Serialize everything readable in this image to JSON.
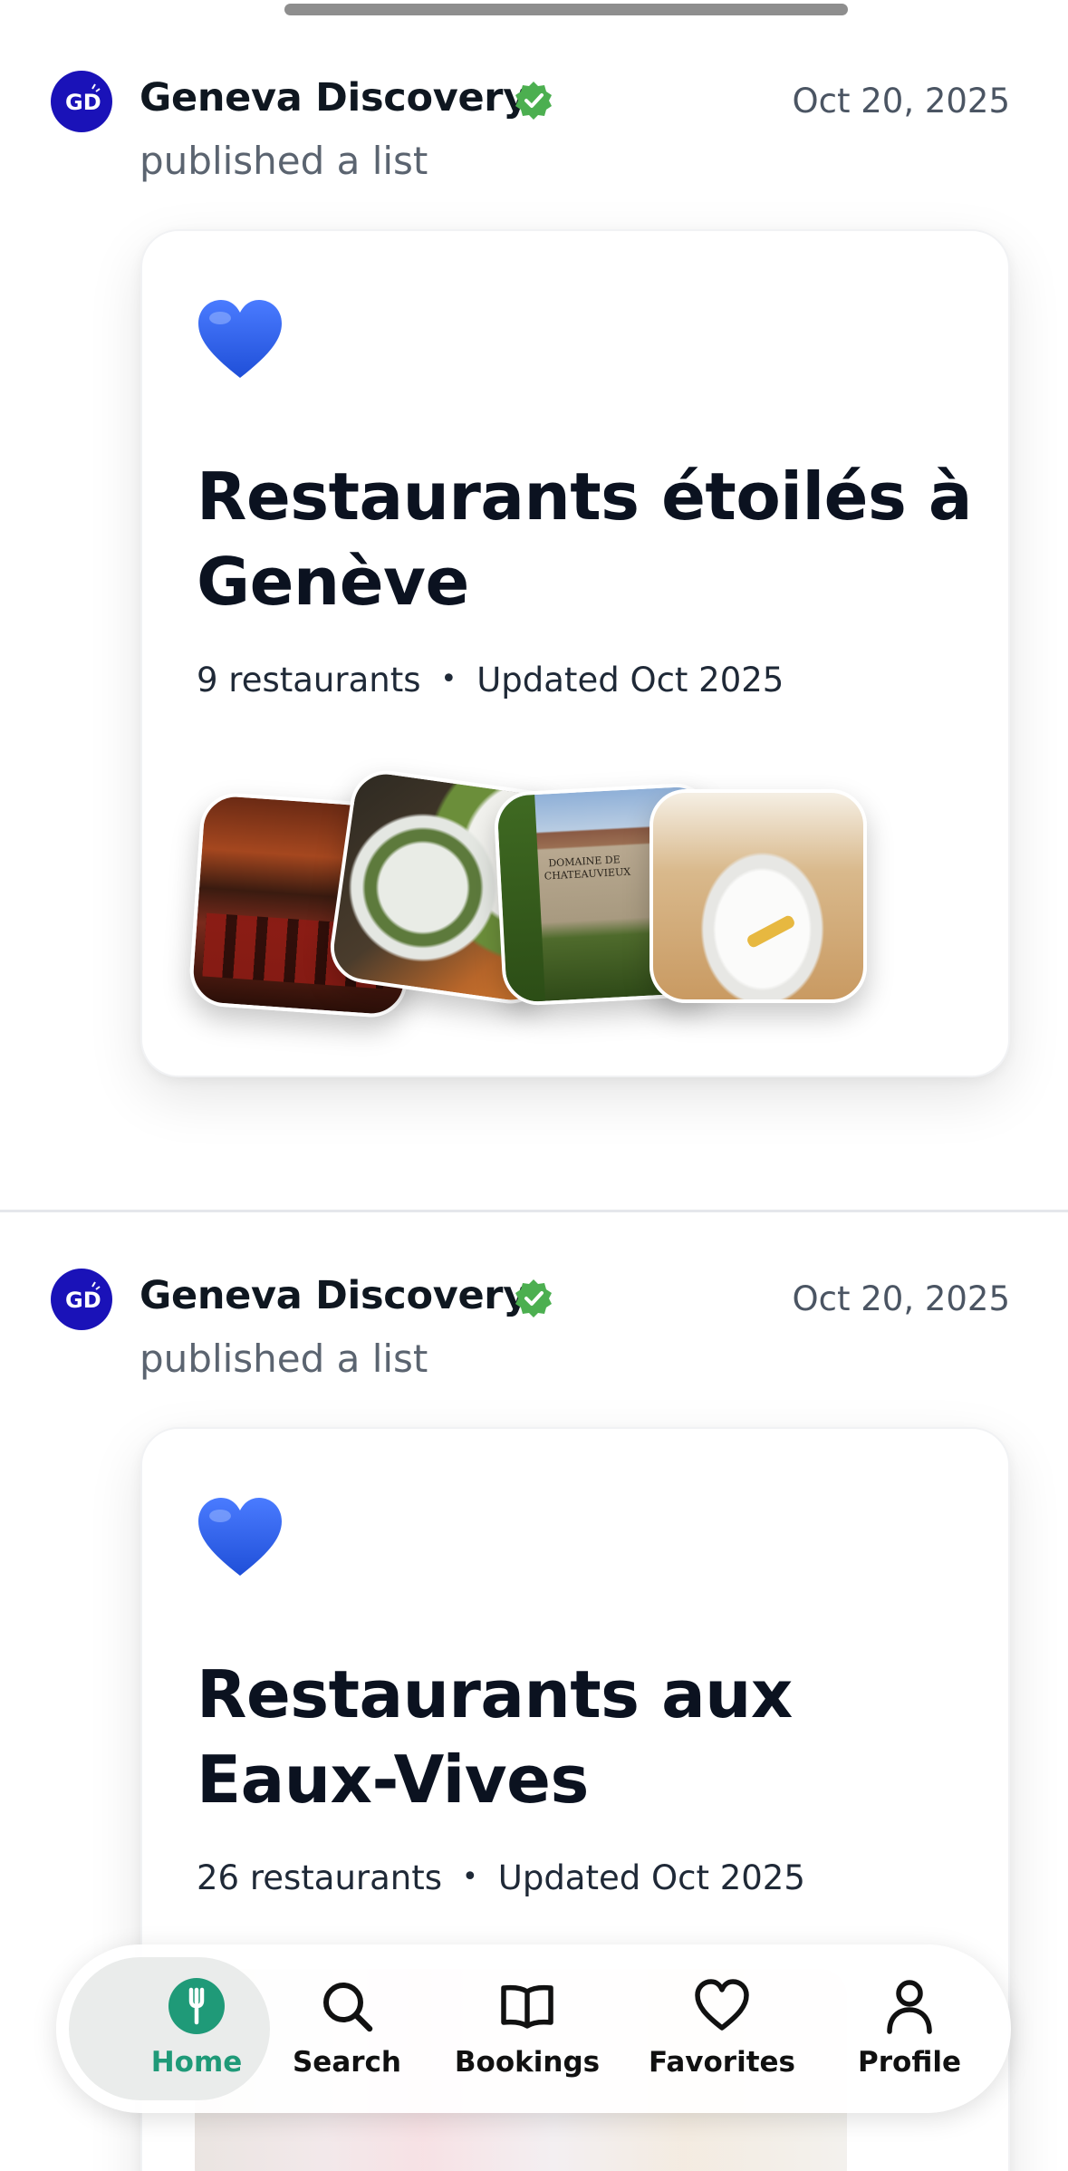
{
  "feed": [
    {
      "author": "Geneva Discovery",
      "verified": true,
      "date": "Oct 20, 2025",
      "action": "published a list",
      "list": {
        "emoji": "blue-heart",
        "title": "Restaurants étoilés à Genève",
        "count": "9 restaurants",
        "separator": "•",
        "updated": "Updated Oct 2025",
        "thumbnails": [
          "restaurant-bar-interior",
          "green-dish-plate",
          "domaine-de-chateauvieux-facade",
          "plated-dessert-table"
        ]
      }
    },
    {
      "author": "Geneva Discovery",
      "verified": true,
      "date": "Oct 20, 2025",
      "action": "published a list",
      "list": {
        "emoji": "blue-heart",
        "title": "Restaurants aux Eaux-Vives",
        "count": "26 restaurants",
        "separator": "•",
        "updated": "Updated Oct 2025"
      }
    }
  ],
  "tabbar": {
    "items": [
      {
        "label": "Home",
        "icon": "fork-icon",
        "active": true
      },
      {
        "label": "Search",
        "icon": "search-icon",
        "active": false
      },
      {
        "label": "Bookings",
        "icon": "book-icon",
        "active": false
      },
      {
        "label": "Favorites",
        "icon": "heart-icon",
        "active": false
      },
      {
        "label": "Profile",
        "icon": "person-icon",
        "active": false
      }
    ]
  },
  "colors": {
    "accent": "#1f9a78",
    "verified": "#4caf50",
    "avatar_bg": "#1a12b8",
    "heart": "#2f62e8"
  }
}
